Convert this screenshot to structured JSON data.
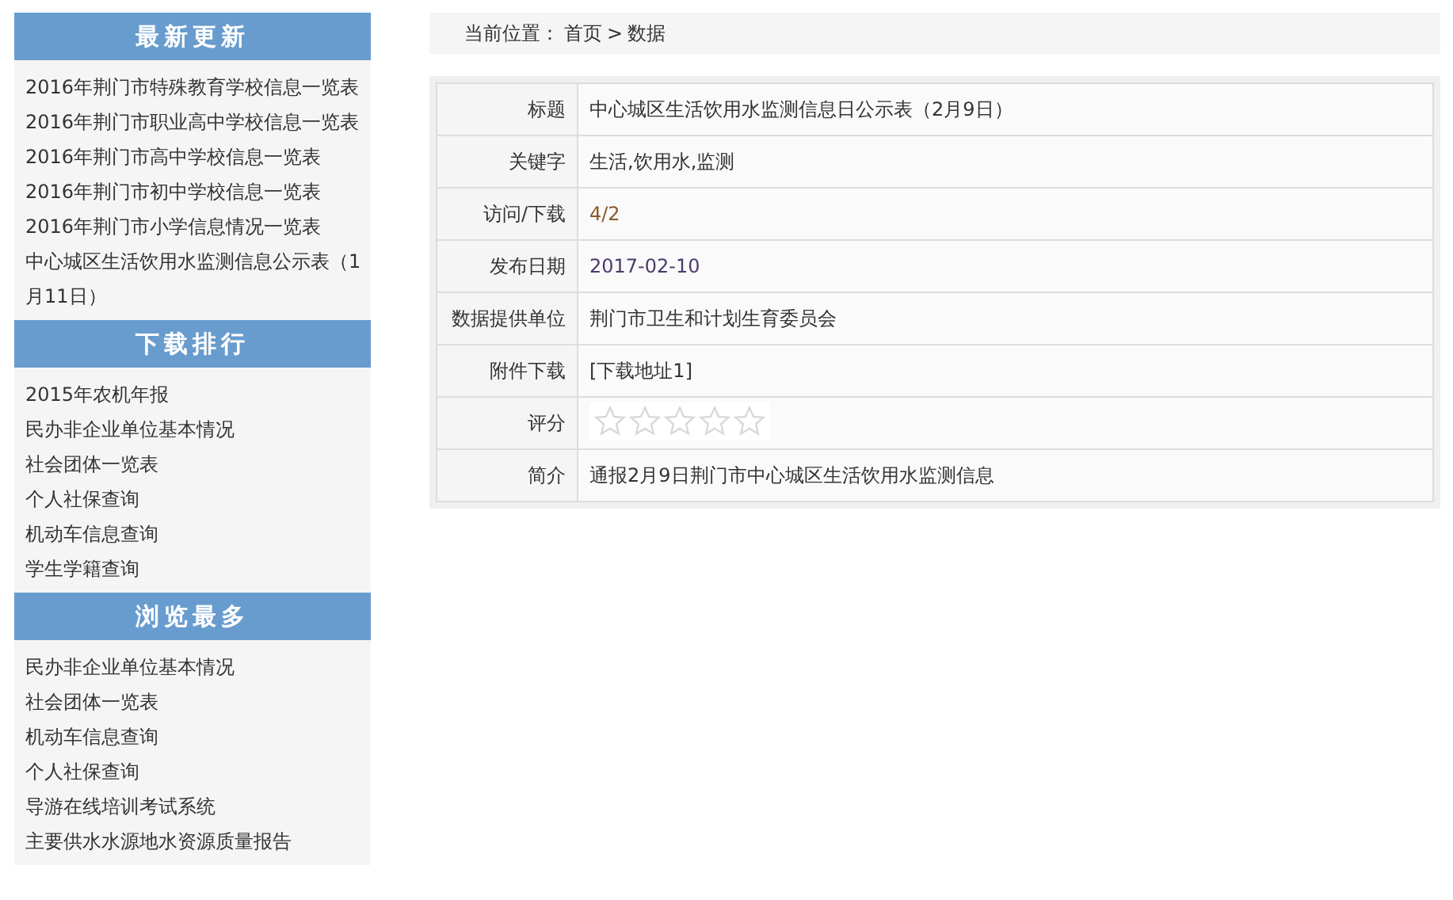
{
  "sidebar": {
    "sections": [
      {
        "title": "最新更新",
        "items": [
          "2016年荆门市特殊教育学校信息一览表",
          "2016年荆门市职业高中学校信息一览表",
          "2016年荆门市高中学校信息一览表",
          "2016年荆门市初中学校信息一览表",
          "2016年荆门市小学信息情况一览表",
          "中心城区生活饮用水监测信息公示表（1月11日）"
        ]
      },
      {
        "title": "下载排行",
        "items": [
          "2015年农机年报",
          "民办非企业单位基本情况",
          "社会团体一览表",
          "个人社保查询",
          "机动车信息查询",
          "学生学籍查询"
        ]
      },
      {
        "title": "浏览最多",
        "items": [
          "民办非企业单位基本情况",
          "社会团体一览表",
          "机动车信息查询",
          "个人社保查询",
          "导游在线培训考试系统",
          "主要供水水源地水资源质量报告"
        ]
      }
    ]
  },
  "breadcrumb": {
    "label": "当前位置：",
    "links": [
      "首页",
      "数据"
    ],
    "separator": ">"
  },
  "details": [
    {
      "label": "标题",
      "kind": "text",
      "value": "中心城区生活饮用水监测信息日公示表（2月9日）"
    },
    {
      "label": "关键字",
      "kind": "text",
      "value": "生活,饮用水,监测"
    },
    {
      "label": "访问/下载",
      "kind": "count",
      "value": "4/2"
    },
    {
      "label": "发布日期",
      "kind": "date",
      "value": "2017-02-10"
    },
    {
      "label": "数据提供单位",
      "kind": "text",
      "value": "荆门市卫生和计划生育委员会"
    },
    {
      "label": "附件下载",
      "kind": "link",
      "value": "[下载地址1]"
    },
    {
      "label": "评分",
      "kind": "rating",
      "stars": 0
    },
    {
      "label": "简介",
      "kind": "text",
      "value": " 通报2月9日荆门市中心城区生活饮用水监测信息"
    }
  ]
}
